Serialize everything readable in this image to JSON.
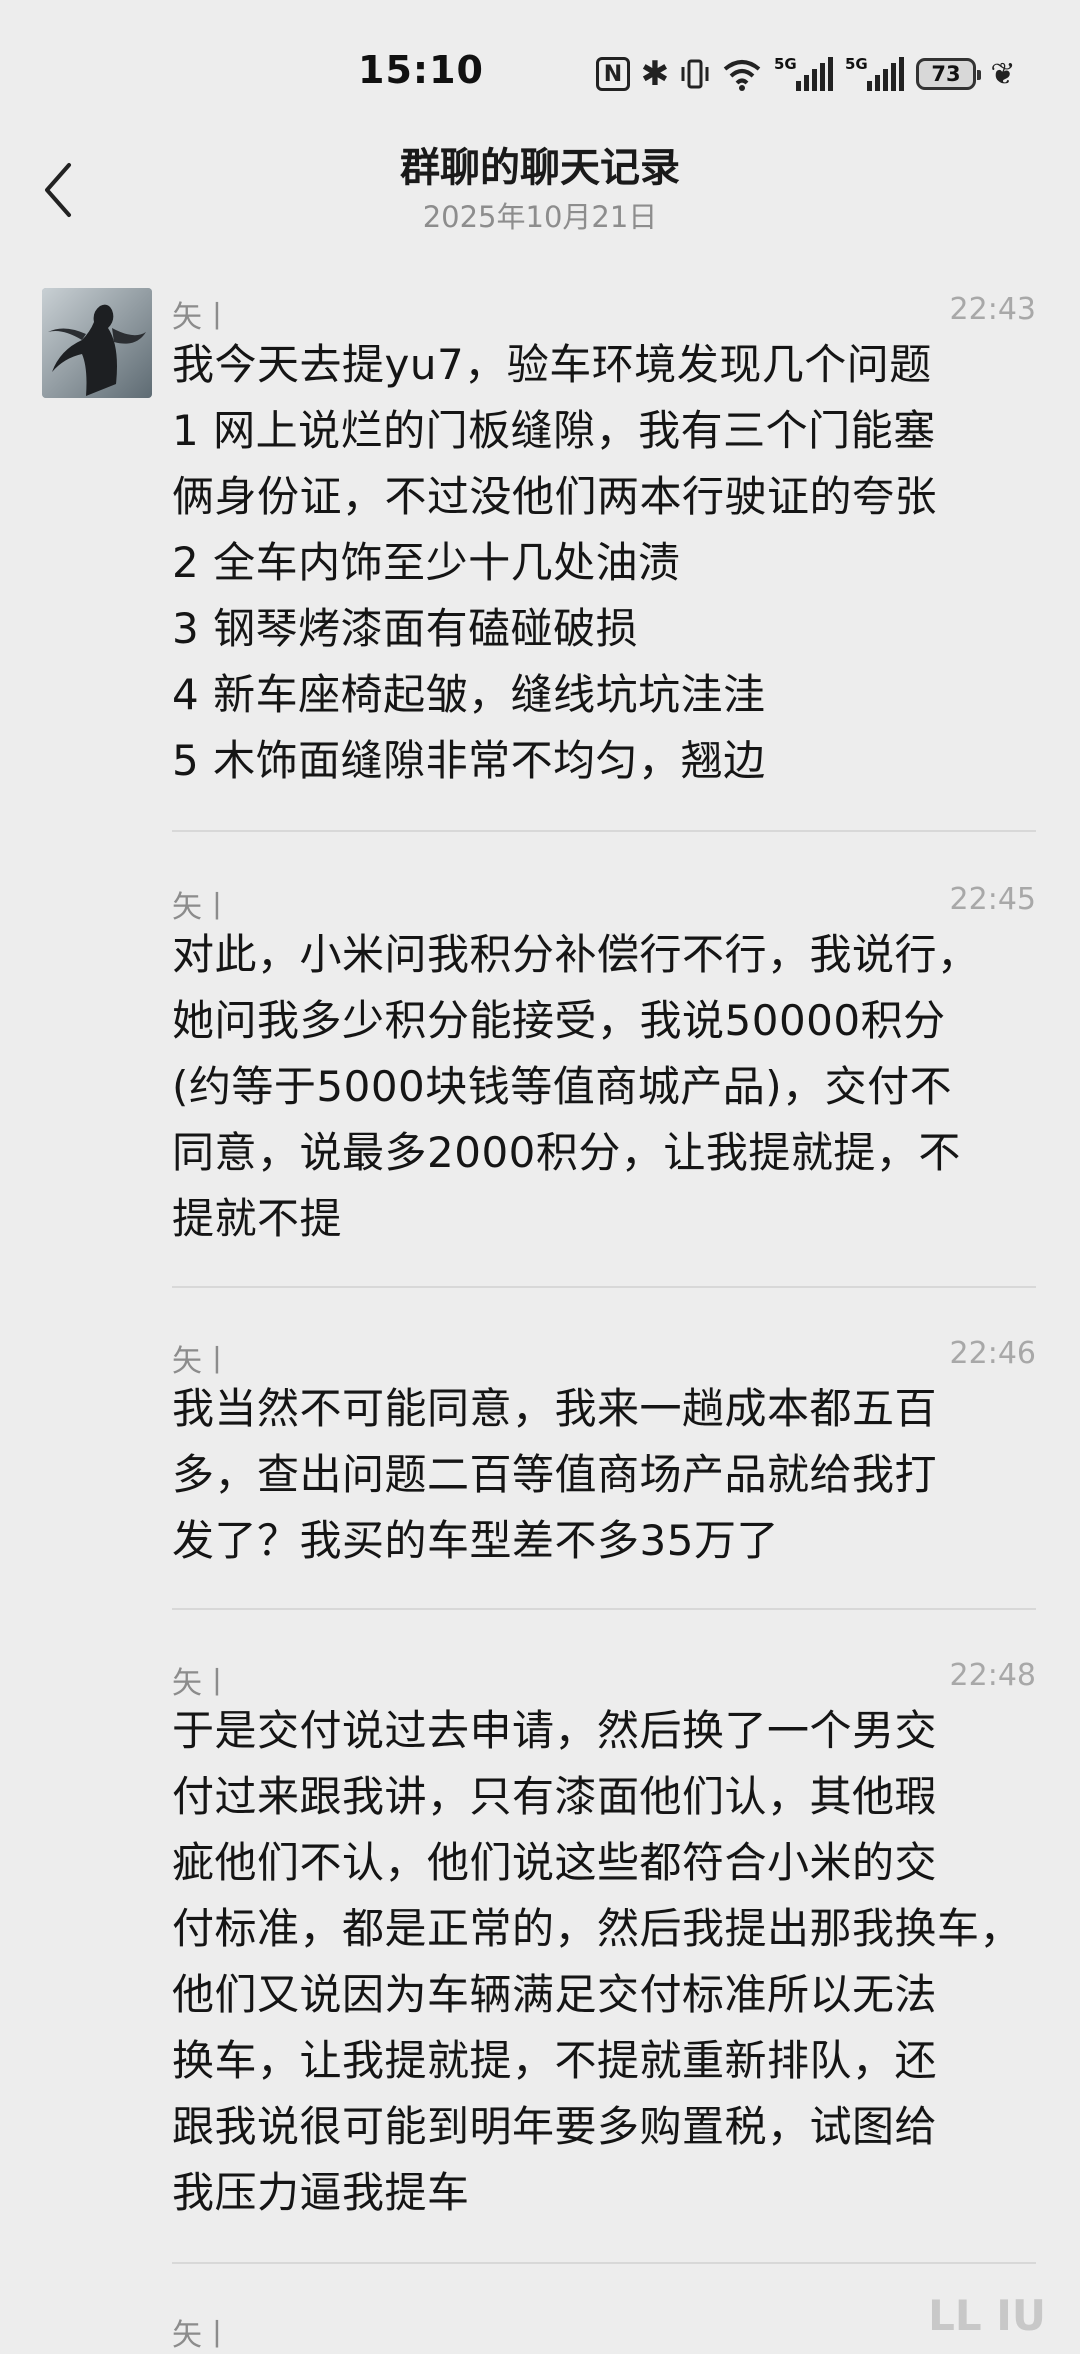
{
  "status_bar": {
    "time": "15:10",
    "icons": [
      "nfc-icon",
      "bluetooth-icon",
      "vibrate-icon",
      "wifi-icon",
      "5g-signal-icon",
      "5g-signal-icon",
      "battery-icon",
      "leaf-icon"
    ],
    "nfc_glyph": "N",
    "bluetooth_glyph": "✱",
    "signal_tag": "5G",
    "battery_level": "73",
    "leaf_glyph": "❦"
  },
  "header": {
    "title": "群聊的聊天记录",
    "subtitle": "2025年10月21日"
  },
  "messages": [
    {
      "sender": "矢丨",
      "time": "22:43",
      "lines": [
        "我今天去提yu7，验车环境发现几个问题",
        "1 网上说烂的门板缝隙，我有三个门能塞",
        "俩身份证，不过没他们两本行驶证的夸张",
        "2 全车内饰至少十几处油渍",
        "3 钢琴烤漆面有磕碰破损",
        "4 新车座椅起皱，缝线坑坑洼洼",
        "5 木饰面缝隙非常不均匀，翘边"
      ]
    },
    {
      "sender": "矢丨",
      "time": "22:45",
      "lines": [
        "对此，小米问我积分补偿行不行，我说行，",
        "她问我多少积分能接受，我说50000积分",
        "(约等于5000块钱等值商城产品)，交付不",
        "同意，说最多2000积分，让我提就提，不",
        "提就不提"
      ]
    },
    {
      "sender": "矢丨",
      "time": "22:46",
      "lines": [
        "我当然不可能同意，我来一趟成本都五百",
        "多，查出问题二百等值商场产品就给我打",
        "发了？我买的车型差不多35万了"
      ]
    },
    {
      "sender": "矢丨",
      "time": "22:48",
      "lines": [
        "于是交付说过去申请，然后换了一个男交",
        "付过来跟我讲，只有漆面他们认，其他瑕",
        "疵他们不认，他们说这些都符合小米的交",
        "付标准，都是正常的，然后我提出那我换车，",
        "他们又说因为车辆满足交付标准所以无法",
        "换车，让我提就提，不提就重新排队，还",
        "跟我说很可能到明年要多购置税，试图给",
        "我压力逼我提车"
      ]
    },
    {
      "sender": "矢丨",
      "time": "",
      "lines": []
    }
  ],
  "watermark": "LL IU"
}
